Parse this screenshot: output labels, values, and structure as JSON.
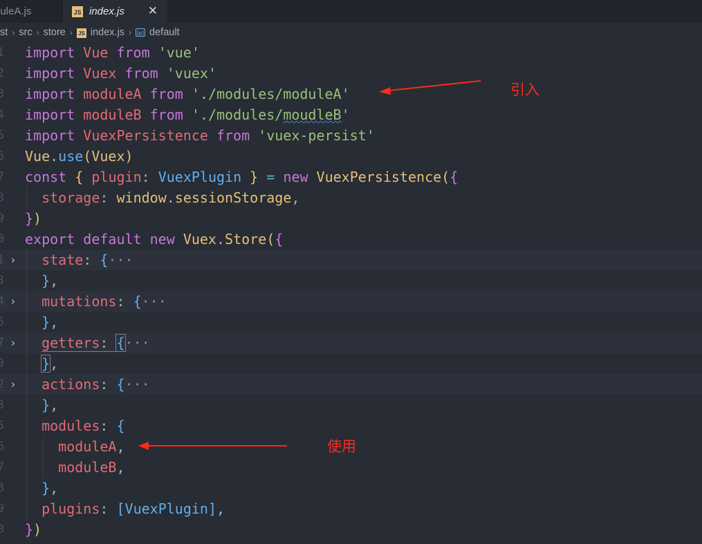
{
  "tabs": [
    {
      "label": "duleA.js",
      "active": false
    },
    {
      "label": "index.js",
      "active": true,
      "icon_text": "JS",
      "close_glyph": "✕"
    }
  ],
  "breadcrumb": {
    "items": [
      "st",
      "src",
      "store",
      "index.js",
      "default"
    ],
    "separator": "›"
  },
  "gutter": {
    "line_numbers": [
      "1",
      "2",
      "3",
      "4",
      "5",
      "6",
      "7",
      "8",
      "9",
      "0",
      "1",
      "3",
      "4",
      "6",
      "7",
      "0",
      "2",
      "3",
      "5",
      "6",
      "7",
      "8",
      "9",
      "0",
      "1"
    ]
  },
  "code": {
    "l1": {
      "kw1": "import",
      "id": "Vue",
      "kw2": "from",
      "str": "'vue'"
    },
    "l2": {
      "kw1": "import",
      "id": "Vuex",
      "kw2": "from",
      "str": "'vuex'"
    },
    "l3": {
      "kw1": "import",
      "id": "moduleA",
      "kw2": "from",
      "str": "'./modules/moduleA'"
    },
    "l4": {
      "kw1": "import",
      "id": "moduleB",
      "kw2": "from",
      "str_a": "'./modules/",
      "str_b": "moudleB",
      "str_c": "'"
    },
    "l5": {
      "kw1": "import",
      "id": "VuexPersistence",
      "kw2": "from",
      "str": "'vuex-persist'"
    },
    "l6": {
      "obj": "Vue",
      "dot": ".",
      "fn": "use",
      "p1": "(",
      "arg": "Vuex",
      "p2": ")"
    },
    "l7": {
      "kw": "const",
      "b1": "{",
      "prop": "plugin",
      "colon": ":",
      "alias": "VuexPlugin",
      "b2": "}",
      "eq": "=",
      "kw2": "new",
      "cls": "VuexPersistence",
      "p": "(",
      "b": "{"
    },
    "l8": {
      "prop": "storage",
      "colon": ":",
      "obj": "window",
      "dot": ".",
      "member": "sessionStorage",
      "comma": ","
    },
    "l9": {
      "b": "}",
      "p": ")"
    },
    "l10": {
      "kw1": "export",
      "kw2": "default",
      "kw3": "new",
      "cls": "Vuex",
      "dot": ".",
      "cls2": "Store",
      "p": "(",
      "b": "{"
    },
    "l11": {
      "prop": "state",
      "colon": ":",
      "b": "{",
      "dots": "···"
    },
    "l12": {
      "b": "}",
      "comma": ","
    },
    "l13": {
      "prop": "mutations",
      "colon": ":",
      "b": "{",
      "dots": "···"
    },
    "l14": {
      "b": "}",
      "comma": ","
    },
    "l15": {
      "prop": "getters",
      "colon": ":",
      "b": "{",
      "dots": "···"
    },
    "l16": {
      "b": "}",
      "comma": ","
    },
    "l17": {
      "prop": "actions",
      "colon": ":",
      "b": "{",
      "dots": "···"
    },
    "l18": {
      "b": "}",
      "comma": ","
    },
    "l19": {
      "prop": "modules",
      "colon": ":",
      "b": "{"
    },
    "l20": {
      "id": "moduleA",
      "comma": ","
    },
    "l21": {
      "id": "moduleB",
      "comma": ","
    },
    "l22": {
      "b": "}",
      "comma": ","
    },
    "l23": {
      "prop": "plugins",
      "colon": ":",
      "lb": "[",
      "id": "VuexPlugin",
      "rb": "]",
      "comma": ","
    },
    "l24": {
      "b": "}",
      "p": ")"
    }
  },
  "fold_glyph": "›",
  "annotations": {
    "import_note": "引入",
    "use_note": "使用",
    "color": "#ff2a1a"
  },
  "theme": {
    "keyword": "#c678dd",
    "variable": "#e06c75",
    "string": "#98c379",
    "class": "#e5c07b",
    "function": "#61afef",
    "background": "#282c34"
  }
}
